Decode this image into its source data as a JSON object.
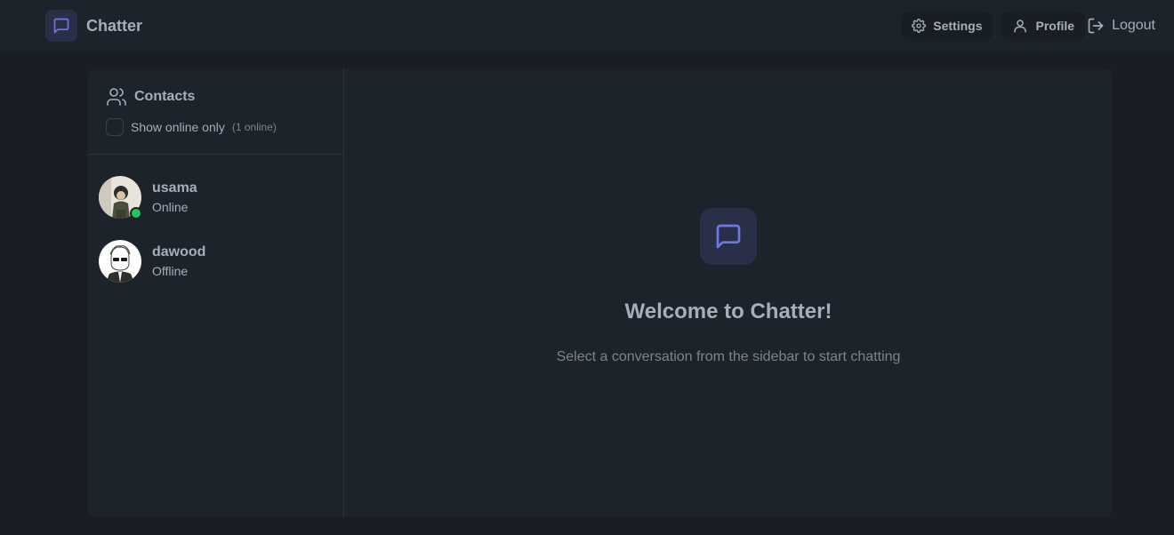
{
  "app": {
    "title": "Chatter",
    "brand_icon": "message-square-icon",
    "accent_color": "#6d78e6"
  },
  "nav": {
    "settings_label": "Settings",
    "profile_label": "Profile",
    "logout_label": "Logout"
  },
  "sidebar": {
    "title": "Contacts",
    "filter_label": "Show online only",
    "online_count": "(1 online)",
    "contacts": [
      {
        "name": "usama",
        "status": "Online",
        "online": true
      },
      {
        "name": "dawood",
        "status": "Offline",
        "online": false
      }
    ]
  },
  "welcome": {
    "title": "Welcome to Chatter!",
    "subtitle": "Select a conversation from the sidebar to start chatting"
  }
}
